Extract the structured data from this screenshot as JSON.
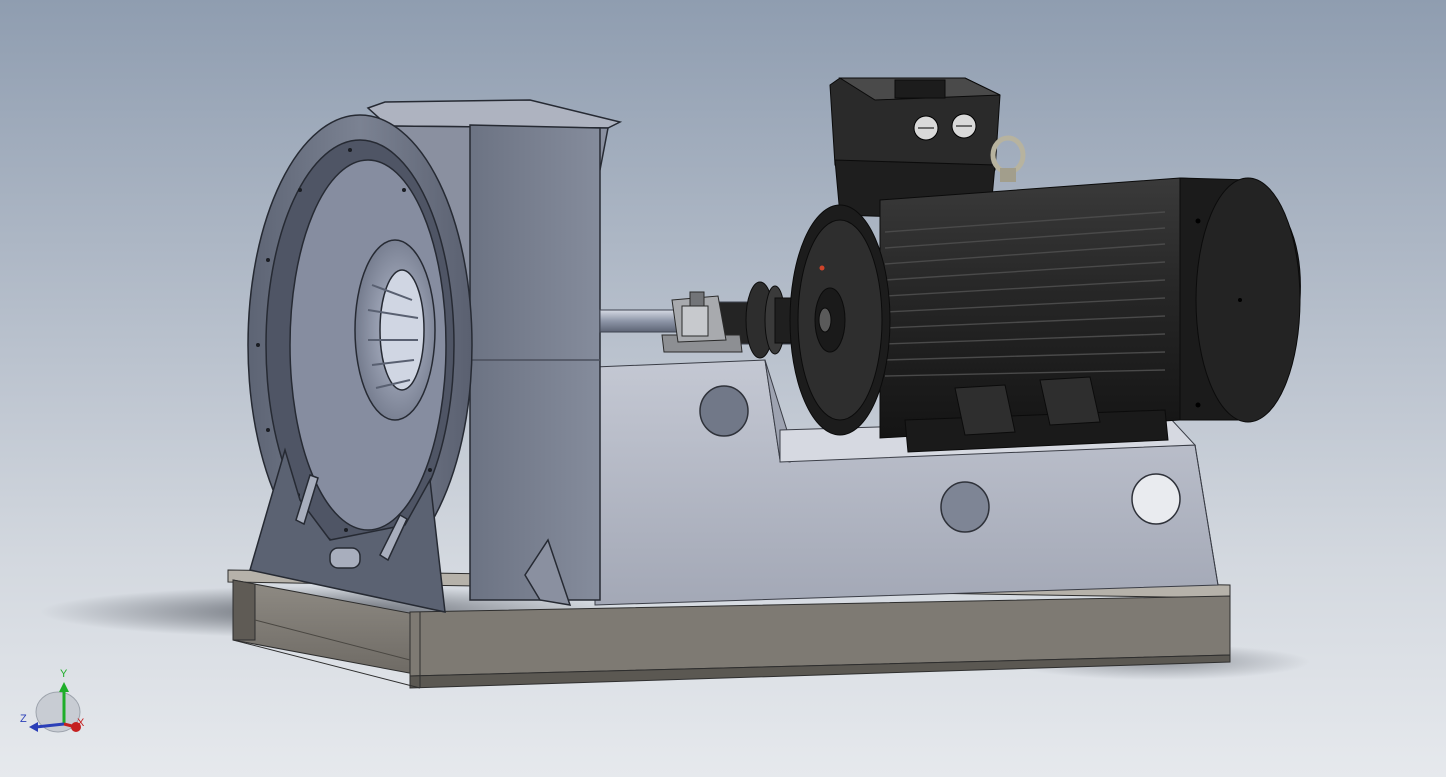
{
  "viewport": {
    "background_top": "#8f9db0",
    "background_bottom": "#e6e9ed",
    "model": "centrifugal-fan-assembly"
  },
  "triad": {
    "x_label": "X",
    "y_label": "Y",
    "z_label": "Z",
    "x_color": "#c52020",
    "y_color": "#1fae2a",
    "z_color": "#2b3fb8"
  }
}
